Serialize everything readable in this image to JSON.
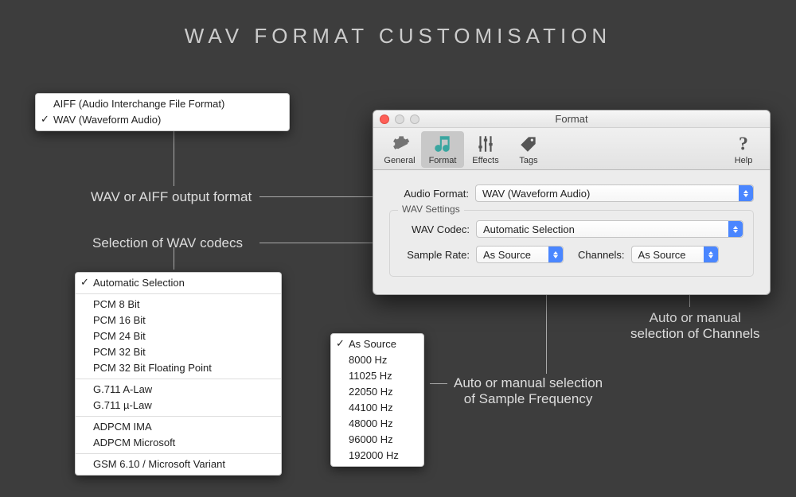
{
  "page_title": "WAV  FORMAT  CUSTOMISATION",
  "annotations": {
    "output_format": "WAV or AIFF output format",
    "codecs": "Selection of WAV codecs",
    "sample": "Auto or manual selection\nof Sample Frequency",
    "channels": "Auto or manual\nselection of Channels"
  },
  "format_menu": {
    "items": [
      {
        "label": "AIFF (Audio Interchange File Format)",
        "checked": false
      },
      {
        "label": "WAV (Waveform Audio)",
        "checked": true
      }
    ]
  },
  "codec_menu": {
    "groups": [
      [
        "Automatic Selection"
      ],
      [
        "PCM 8 Bit",
        "PCM 16 Bit",
        "PCM 24 Bit",
        "PCM 32 Bit",
        "PCM 32 Bit Floating Point"
      ],
      [
        "G.711 A-Law",
        "G.711 µ-Law"
      ],
      [
        "ADPCM IMA",
        "ADPCM Microsoft"
      ],
      [
        "GSM 6.10 / Microsoft Variant"
      ]
    ],
    "checked": "Automatic Selection"
  },
  "rate_menu": {
    "items": [
      "As Source",
      "8000 Hz",
      "11025 Hz",
      "22050 Hz",
      "44100 Hz",
      "48000 Hz",
      "96000 Hz",
      "192000 Hz"
    ],
    "checked": "As Source"
  },
  "window": {
    "title": "Format",
    "tabs": [
      "General",
      "Format",
      "Effects",
      "Tags"
    ],
    "selected_tab": "Format",
    "help": "Help",
    "labels": {
      "audio_format": "Audio Format:",
      "settings_group": "WAV Settings",
      "wav_codec": "WAV Codec:",
      "sample_rate": "Sample Rate:",
      "channels": "Channels:"
    },
    "values": {
      "audio_format": "WAV (Waveform Audio)",
      "wav_codec": "Automatic Selection",
      "sample_rate": "As Source",
      "channels": "As Source"
    }
  }
}
